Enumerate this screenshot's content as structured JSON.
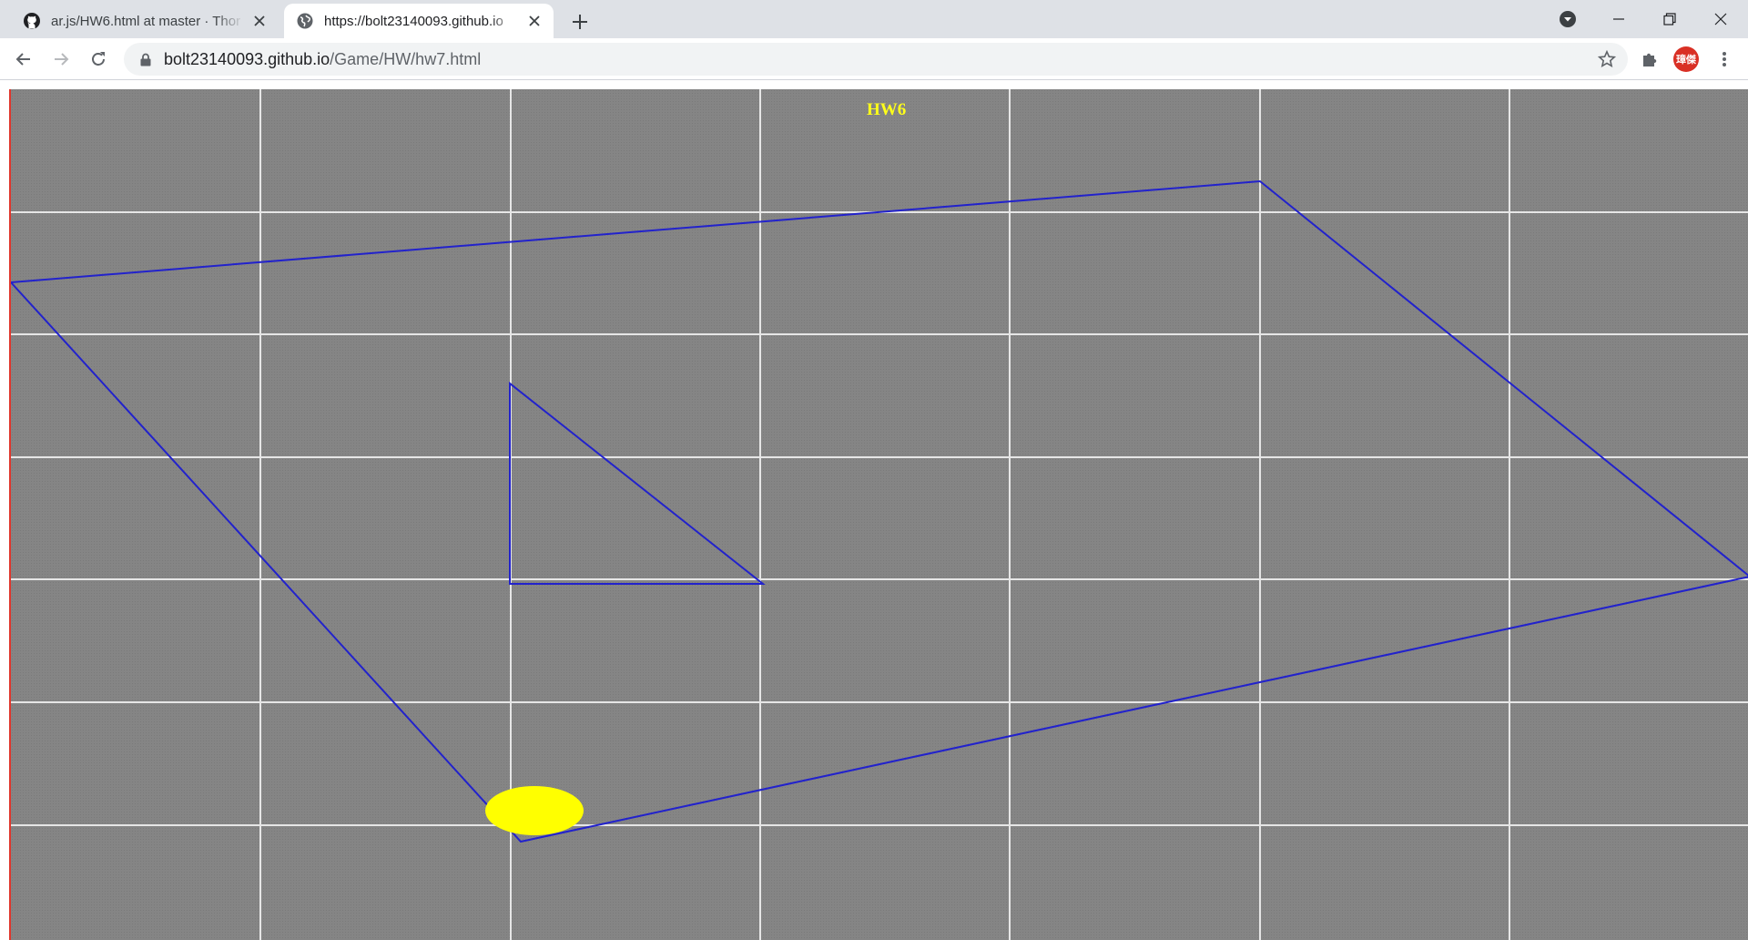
{
  "browser": {
    "tabs": [
      {
        "title": "ar.js/HW6.html at master · Thor",
        "icon": "github-icon",
        "active": false
      },
      {
        "title": "https://bolt23140093.github.io",
        "icon": "globe-icon",
        "active": true
      }
    ],
    "new_tab_icon": "plus-icon",
    "window_controls": [
      "profile-dropdown-icon",
      "minimize-icon",
      "restore-icon",
      "close-icon"
    ],
    "address_bar": {
      "host": "bolt23140093.github.io",
      "path": "/Game/HW/hw7.html"
    },
    "avatar_text": "璋傑",
    "avatar_color": "#d93025"
  },
  "page": {
    "title": "HW6",
    "title_color": "#ffff1a",
    "canvas": {
      "background": "#858585",
      "grid_color": "#e6e6e6",
      "shape_stroke": "#2222cc",
      "ball_color": "#ffff00",
      "grid_columns": 7,
      "grid_rows": 7
    }
  }
}
